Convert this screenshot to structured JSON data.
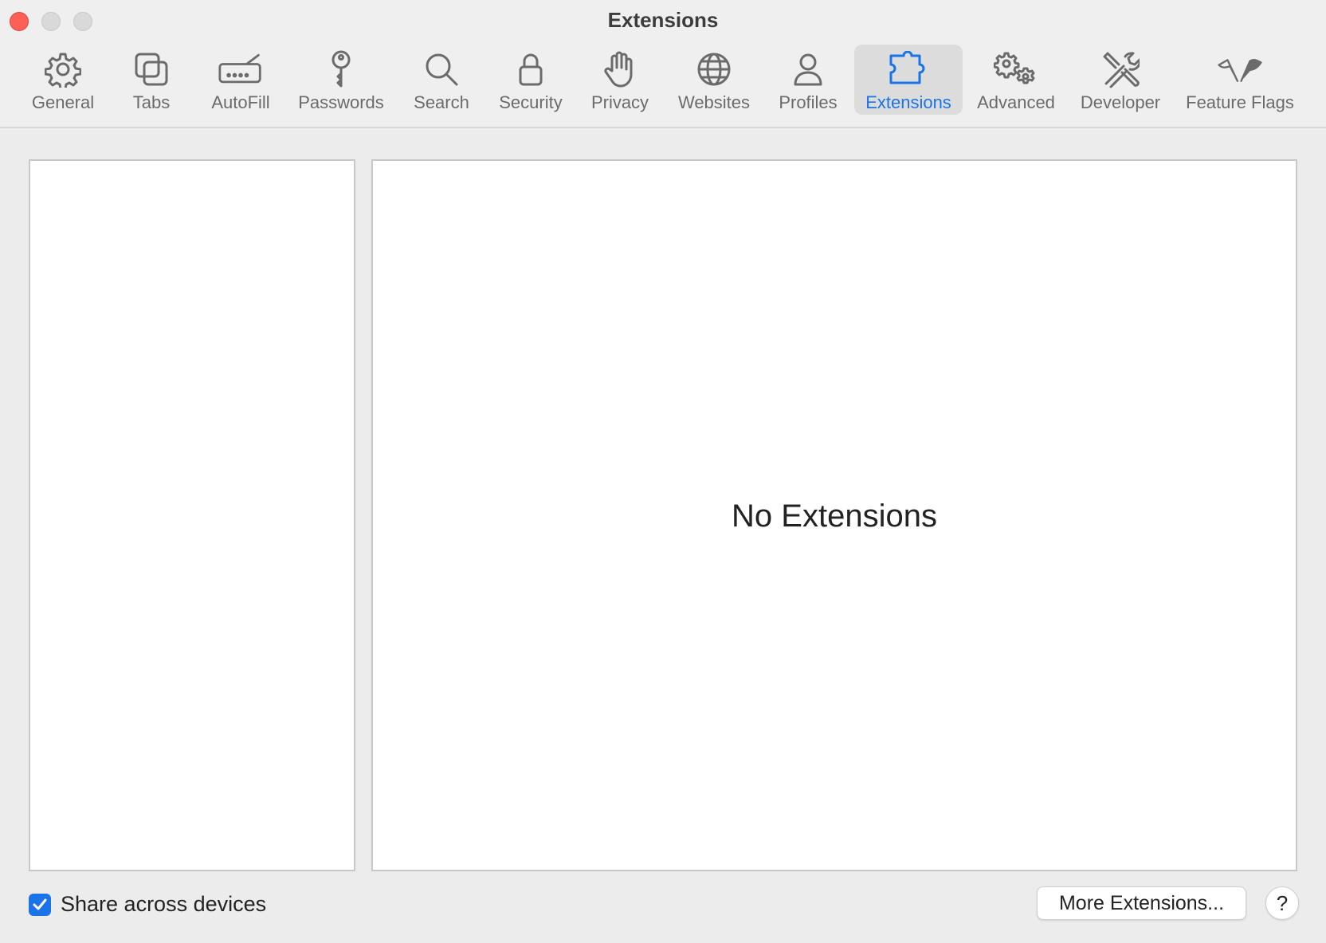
{
  "window": {
    "title": "Extensions"
  },
  "toolbar": {
    "items": [
      {
        "label": "General",
        "icon": "gear-icon"
      },
      {
        "label": "Tabs",
        "icon": "tabs-icon"
      },
      {
        "label": "AutoFill",
        "icon": "autofill-icon"
      },
      {
        "label": "Passwords",
        "icon": "key-icon"
      },
      {
        "label": "Search",
        "icon": "search-icon"
      },
      {
        "label": "Security",
        "icon": "lock-icon"
      },
      {
        "label": "Privacy",
        "icon": "hand-icon"
      },
      {
        "label": "Websites",
        "icon": "globe-icon"
      },
      {
        "label": "Profiles",
        "icon": "person-icon"
      },
      {
        "label": "Extensions",
        "icon": "puzzle-icon",
        "selected": true
      },
      {
        "label": "Advanced",
        "icon": "gears-icon"
      },
      {
        "label": "Developer",
        "icon": "tools-icon"
      },
      {
        "label": "Feature Flags",
        "icon": "flags-icon"
      }
    ]
  },
  "main": {
    "empty_message": "No Extensions"
  },
  "footer": {
    "share_label": "Share across devices",
    "share_checked": true,
    "more_extensions_label": "More Extensions...",
    "help_label": "?"
  },
  "colors": {
    "accent": "#1a73e8",
    "close_button": "#fe5f57"
  }
}
